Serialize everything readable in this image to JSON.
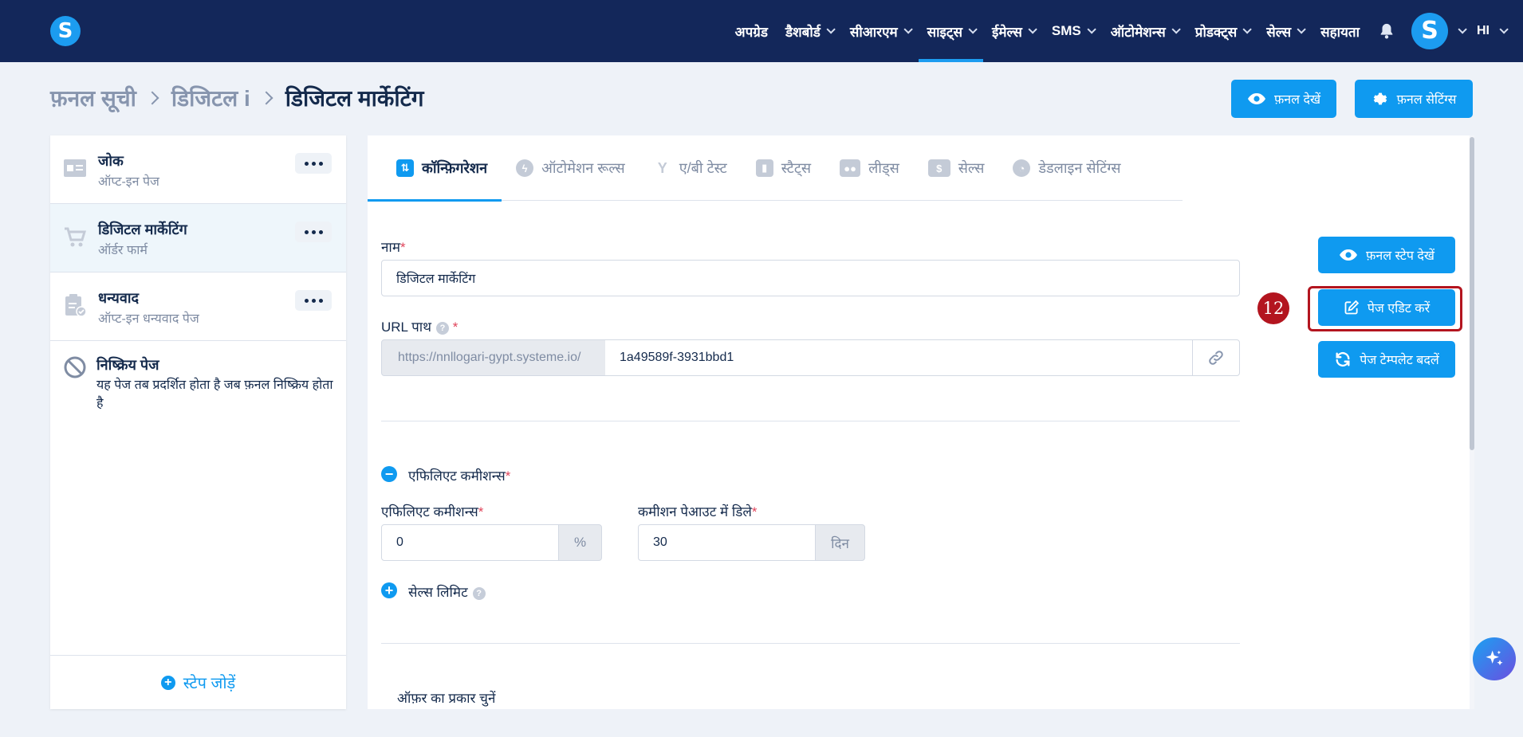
{
  "nav": {
    "items": [
      {
        "label": "अपग्रेड",
        "dropdown": false
      },
      {
        "label": "डैशबोर्ड",
        "dropdown": true
      },
      {
        "label": "सीआरएम",
        "dropdown": true
      },
      {
        "label": "साइट्स",
        "dropdown": true,
        "active": true
      },
      {
        "label": "ईमेल्स",
        "dropdown": true
      },
      {
        "label": "SMS",
        "dropdown": true
      },
      {
        "label": "ऑटोमेशन्स",
        "dropdown": true
      },
      {
        "label": "प्रोडक्ट्स",
        "dropdown": true
      },
      {
        "label": "सेल्स",
        "dropdown": true
      },
      {
        "label": "सहायता",
        "dropdown": false
      }
    ],
    "logo_letter": "S",
    "avatar_letter": "S",
    "language": "HI",
    "accent": "#1c9cf0",
    "bg": "#13275a"
  },
  "breadcrumb": {
    "items": [
      "फ़नल सूची",
      "डिजिटल i",
      "डिजिटल मार्केटिंग"
    ]
  },
  "header_actions": {
    "view_funnel": "फ़नल देखें",
    "funnel_settings": "फ़नल सेटिंग्स"
  },
  "steps": [
    {
      "title": "जोक",
      "subtitle": "ऑप्ट-इन पेज",
      "icon": "optin-page-icon"
    },
    {
      "title": "डिजिटल मार्केटिंग",
      "subtitle": "ऑर्डर फार्म",
      "icon": "cart-icon",
      "active": true
    },
    {
      "title": "धन्यवाद",
      "subtitle": "ऑप्ट-इन धन्यवाद पेज",
      "icon": "clipboard-check-icon"
    }
  ],
  "inactive_page": {
    "title": "निष्क्रिय पेज",
    "description": "यह पेज तब प्रदर्शित होता है जब फ़नल निष्क्रिय होता है"
  },
  "add_step_label": "स्टेप जोड़ें",
  "tabs": [
    {
      "label": "कॉन्फ़िगरेशन",
      "icon": "sliders-icon",
      "active": true
    },
    {
      "label": "ऑटोमेशन रूल्स",
      "icon": "bolt-icon"
    },
    {
      "label": "ए/बी टेस्ट",
      "icon": "split-icon"
    },
    {
      "label": "स्टैट्स",
      "icon": "bar-chart-icon"
    },
    {
      "label": "लीड्स",
      "icon": "users-icon"
    },
    {
      "label": "सेल्स",
      "icon": "dollar-icon"
    },
    {
      "label": "डेडलाइन सेटिंग्स",
      "icon": "clock-icon"
    }
  ],
  "form": {
    "name_label": "नाम",
    "name_value": "डिजिटल मार्केटिंग",
    "url_label": "URL पाथ",
    "url_prefix": "https://nnllogari-gypt.systeme.io/",
    "url_value": "1a49589f-3931bbd1",
    "affiliate_section_label": "एफिलिएट कमीशन्स",
    "affiliate_commission_label": "एफिलिएट कमीशन्स",
    "affiliate_commission_value": "0",
    "affiliate_commission_unit": "%",
    "payout_delay_label": "कमीशन पेआउट में डिले",
    "payout_delay_value": "30",
    "payout_delay_unit": "दिन",
    "sales_limit_label": "सेल्स लिमिट",
    "offer_type_label": "ऑफ़र का प्रकार चुनें",
    "required_mark": "*",
    "help_mark": "?"
  },
  "side_actions": {
    "view_step": "फ़नल स्टेप देखें",
    "edit_page": "पेज एडिट करें",
    "change_template": "पेज टेम्पलेट बदलें"
  },
  "annotation": {
    "step_number": "12",
    "color": "#b3151f"
  }
}
